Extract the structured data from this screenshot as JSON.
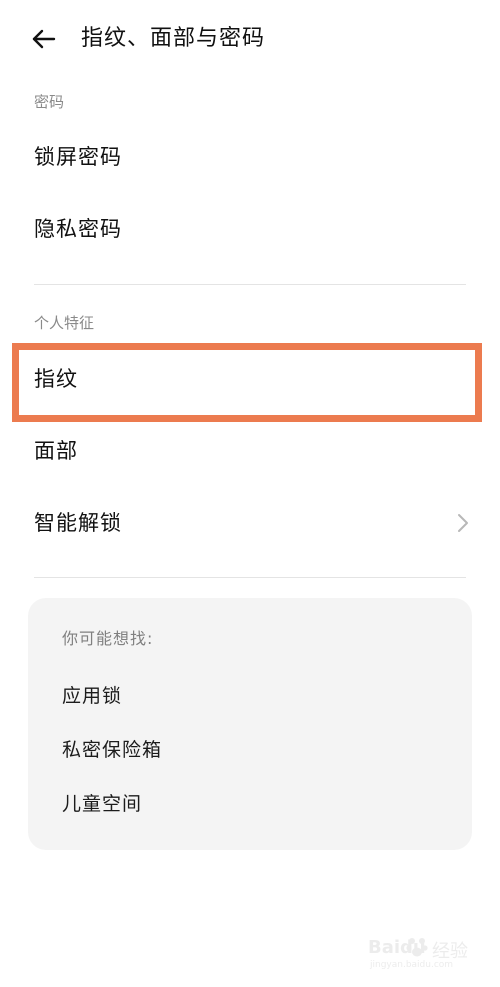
{
  "header": {
    "title": "指纹、面部与密码",
    "back_icon": "arrow-left-icon"
  },
  "sections": {
    "password": {
      "title": "密码",
      "items": [
        {
          "label": "锁屏密码"
        },
        {
          "label": "隐私密码"
        }
      ]
    },
    "biometrics": {
      "title": "个人特征",
      "items": [
        {
          "label": "指纹",
          "highlighted": true
        },
        {
          "label": "面部"
        },
        {
          "label": "智能解锁",
          "chevron": true
        }
      ]
    }
  },
  "suggestions": {
    "title": "你可能想找:",
    "items": [
      {
        "label": "应用锁"
      },
      {
        "label": "私密保险箱"
      },
      {
        "label": "儿童空间"
      }
    ]
  },
  "watermark": {
    "brand": "Baidu",
    "text": "经验",
    "url": "jingyan.baidu.com"
  },
  "colors": {
    "highlight": "#ec7b4f",
    "secondary_text": "#8a8a8a",
    "card_bg": "#f4f4f4",
    "divider": "#e4e4e4"
  }
}
